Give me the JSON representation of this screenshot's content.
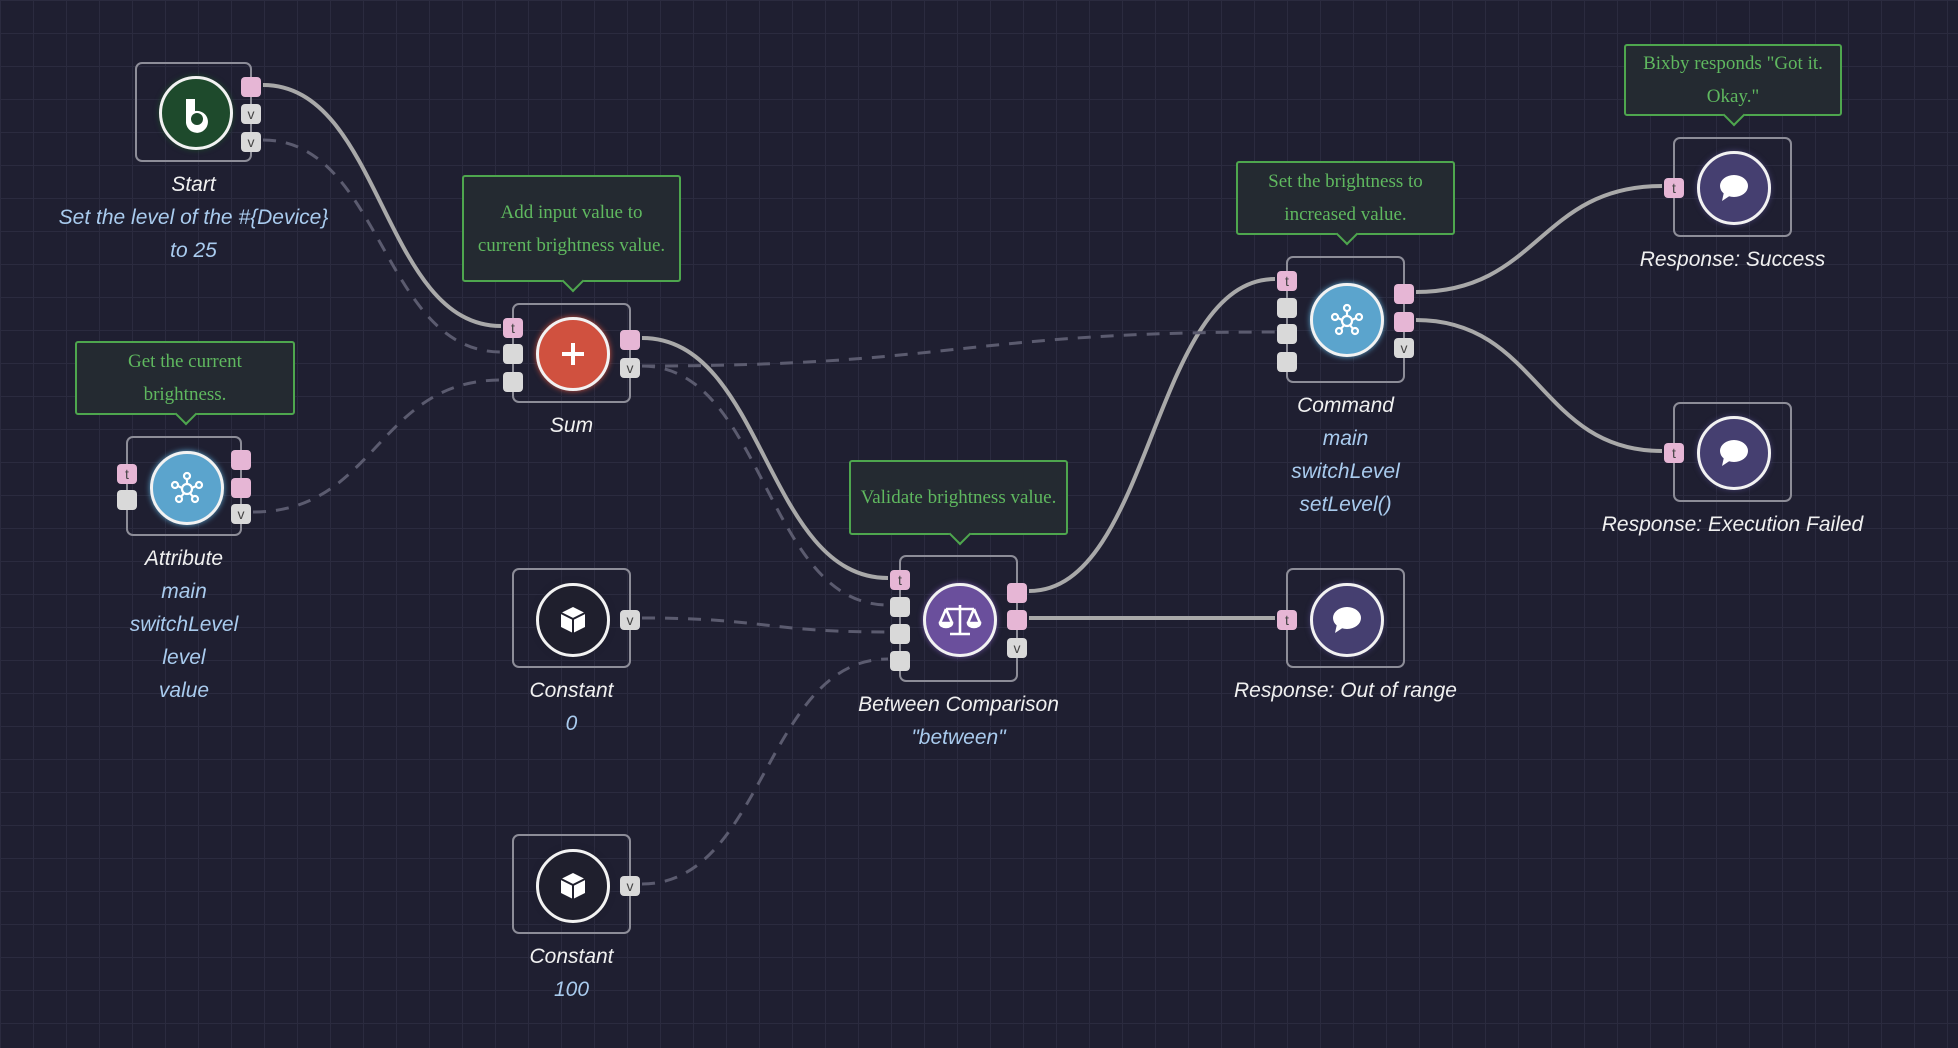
{
  "colors": {
    "start": "#1e4a2c",
    "sum": "#d0513f",
    "attribute": "#5ba4cd",
    "constant": "#1f1f2d",
    "between": "#6a4f9c",
    "command": "#5ba4cd",
    "response": "#453f70",
    "trigger_port": "#e6b6d5",
    "value_port": "#d9d9d9",
    "comment": "#5fb85f"
  },
  "nodes": {
    "start": {
      "icon": "bixby-icon",
      "title": "Start",
      "sub": [
        "Set the level of the #{Device}",
        "to 25"
      ],
      "ports": {
        "v": "v"
      }
    },
    "sum": {
      "icon": "plus-icon",
      "title": "Sum",
      "comment": "Add input value to current brightness value.",
      "ports": {
        "t": "t",
        "v": "v"
      }
    },
    "attribute": {
      "icon": "network-icon",
      "title": "Attribute",
      "sub": [
        "main",
        "switchLevel",
        "level",
        "value"
      ],
      "comment": "Get the current brightness.",
      "ports": {
        "t": "t",
        "v": "v"
      }
    },
    "constant0": {
      "icon": "cube-icon",
      "title": "Constant",
      "sub": [
        "0"
      ],
      "ports": {
        "v": "v"
      }
    },
    "constant100": {
      "icon": "cube-icon",
      "title": "Constant",
      "sub": [
        "100"
      ],
      "ports": {
        "v": "v"
      }
    },
    "between": {
      "icon": "balance-scale-icon",
      "title": "Between Comparison",
      "sub": [
        "\"between\""
      ],
      "comment": "Validate brightness value.",
      "ports": {
        "t": "t",
        "v": "v"
      }
    },
    "command": {
      "icon": "network-icon",
      "title": "Command",
      "sub": [
        "main",
        "switchLevel",
        "setLevel()"
      ],
      "comment": "Set the brightness to increased value.",
      "ports": {
        "t": "t",
        "v": "v"
      }
    },
    "out_of_range": {
      "icon": "chat-bubble-icon",
      "title": "Response: Out of range",
      "ports": {
        "t": "t"
      }
    },
    "success": {
      "icon": "chat-bubble-icon",
      "title": "Response: Success",
      "comment": "Bixby responds \"Got it. Okay.\"",
      "ports": {
        "t": "t"
      }
    },
    "failed": {
      "icon": "chat-bubble-icon",
      "title": "Response: Execution Failed",
      "ports": {
        "t": "t"
      }
    }
  },
  "edges": [
    {
      "from": "start-o1",
      "to": "sum-i1",
      "kind": "flow"
    },
    {
      "from": "sum-o1",
      "to": "between-i1",
      "kind": "flow"
    },
    {
      "from": "between-o1",
      "to": "command-i1",
      "kind": "flow"
    },
    {
      "from": "between-o2",
      "to": "out_of_range-i1",
      "kind": "flow"
    },
    {
      "from": "command-o1",
      "to": "success-i1",
      "kind": "flow"
    },
    {
      "from": "command-o2",
      "to": "failed-i1",
      "kind": "flow"
    },
    {
      "from": "start-o3",
      "to": "sum-i2",
      "kind": "value"
    },
    {
      "from": "attribute-o3",
      "to": "sum-i3",
      "kind": "value"
    },
    {
      "from": "sum-o2",
      "to": "command-i3",
      "kind": "value"
    },
    {
      "from": "sum-o2",
      "to": "between-i2",
      "kind": "value"
    },
    {
      "from": "constant0-o1",
      "to": "between-i3",
      "kind": "value"
    },
    {
      "from": "constant100-o1",
      "to": "between-i4",
      "kind": "value"
    }
  ]
}
